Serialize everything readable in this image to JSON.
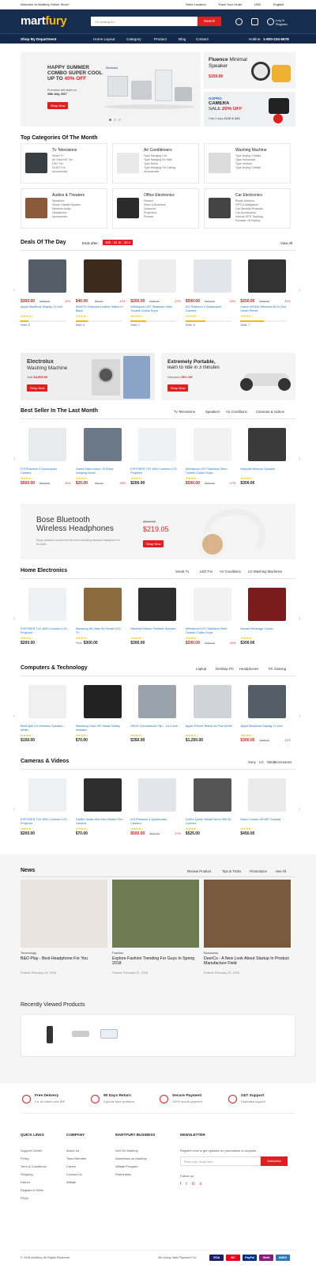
{
  "topbar": {
    "welcome": "Welcome to Martfury Online Store !",
    "store_location": "Store Location",
    "track_order": "Track Your Order",
    "currency": "USD",
    "language": "English"
  },
  "header": {
    "logo_a": "mart",
    "logo_b": "fury",
    "search_placeholder": "I'm looking for...",
    "search_button": "Search",
    "login": "Log In",
    "register": "Register"
  },
  "nav": {
    "shop_by_department": "Shop By Department",
    "items": [
      "Home Layout",
      "Category",
      "Product",
      "Blog",
      "Contact"
    ],
    "hotline_label": "Hotline:",
    "hotline": "1-800-234-5678"
  },
  "hero": {
    "line1": "HAPPY SUMMER",
    "line2": "COMBO SUPER COOL",
    "line3": "UP TO",
    "discount": "40% OFF",
    "brand": "Electrolux",
    "promo_note": "Promotion will expire on",
    "promo_date": "30th July, 2017",
    "button": "Shop Now",
    "right1": {
      "title": "Fluence",
      "title2": "Minimal",
      "title3": "Speaker",
      "price": "$159.99"
    },
    "right2": {
      "title": "GOPRO",
      "title2": "CAMERA",
      "title3": "SALE",
      "discount": "20% OFF",
      "note": "Only 3 days",
      "date": "21/10 & 3/10"
    }
  },
  "categories": {
    "title": "Top Categories Of The Month",
    "items": [
      {
        "name": "Tv Televisions",
        "subs": [
          "Smart Tv",
          "4K Ultra HD Tvs",
          "LED Tvs",
          "OLED Tvs",
          "Accessories"
        ]
      },
      {
        "name": "Air Conditioners",
        "subs": [
          "Type Hanging Cell",
          "Type Hanging On Wall",
          "Type Direct",
          "Type Hanging On Ceiling",
          "Accessories"
        ]
      },
      {
        "name": "Washing Machine",
        "subs": [
          "Type Drying Clothes",
          "Type Horizontal",
          "Type Vertical",
          "Type Drying Clothes"
        ]
      },
      {
        "name": "Audios & Theaters",
        "subs": [
          "Speakers",
          "Home Theater System",
          "Wireless Audio",
          "Headphone",
          "Accessories"
        ]
      },
      {
        "name": "Office Electronics",
        "subs": [
          "Printers",
          "Store & Business",
          "Scanners",
          "Projectors",
          "Phones"
        ]
      },
      {
        "name": "Car Electronics",
        "subs": [
          "Radar Detector",
          "GPS & Navigation",
          "Car Security Products",
          "Car Accessories",
          "Vehicle GPS Tracking",
          "Portable CB Radios"
        ]
      }
    ]
  },
  "deals": {
    "title": "Deals Of The Day",
    "ends_label": "Ends after:",
    "timer": "16h : 31 m : 10 s",
    "view_all": "View All",
    "items": [
      {
        "price": "$300.00",
        "old": "$399.00",
        "disc": "-11%",
        "name": "Apple MacBook Display 12 inch",
        "sold": "Sold: 9"
      },
      {
        "price": "$40.00",
        "old": "$60.00",
        "disc": "-11%",
        "name": "MVMTH Classical Leather Watch In Black",
        "sold": "Sold: 6"
      },
      {
        "price": "$200.00",
        "old": "$299.00",
        "disc": "-17%",
        "name": "Whirlepool UST Stainless Steel Tumble Clothe Dryer",
        "sold": "Sold: 1"
      },
      {
        "price": "$500.00",
        "old": "$599.00",
        "disc": "-11%",
        "name": "DJI Phantom 4 Quadcopter Camera",
        "sold": "Sold: 6"
      },
      {
        "price": "$250.00",
        "old": "$299.00",
        "disc": "-11%",
        "name": "Canon MX460 Wireless All-In-One Smart Printer",
        "sold": "Sold: 7"
      }
    ]
  },
  "banners": {
    "b1": {
      "brand": "Electrolux",
      "title": "Washing Machine",
      "price_label": "Just",
      "price": "$4,599.00",
      "button": "Shop Now"
    },
    "b2": {
      "title1": "Extremely Portable,",
      "title2": "learn to ride in 3 minutes",
      "discount_label": "Discount",
      "discount": "25% Off",
      "button": "Shop Now"
    }
  },
  "bestseller": {
    "title": "Best Seller In The Last Month",
    "tabs": [
      "Tv Televisions",
      "Speakers",
      "Air Conditions",
      "Cameras & Videos"
    ],
    "items": [
      {
        "name": "DJI Phantom 4 Quadcopter Camera",
        "price": "$500.00",
        "old": "$600.00",
        "disc": "-11%"
      },
      {
        "name": "Grand Slam Indoor Of Show Jumping Novel",
        "price": "$20.00",
        "old": "$30.00",
        "disc": "-33%"
      },
      {
        "name": "EXPOSER T20 1600 Lumens LCD Projector",
        "price": "$200.00",
        "old": "",
        "disc": ""
      },
      {
        "name": "Whirlepool UST Stainless Steel Tumble Clothe Dryer",
        "price": "$500.00",
        "old": "$600.00",
        "disc": "-17%"
      },
      {
        "name": "Marshall Woburn Speaker",
        "price": "$300.00",
        "old": "",
        "disc": ""
      }
    ]
  },
  "bose": {
    "title1": "Bose Bluetooth",
    "title2": "Wireless Headphones",
    "old": "$299.00",
    "price": "$219.05",
    "desc": "Enjoy powerful sound from the best sounding wireless headphone in its class",
    "button": "Shop Now"
  },
  "home_electronics": {
    "title": "Home Electronics",
    "tabs": [
      "Smart Tv",
      "LED Tvs",
      "Air Conditions",
      "LG Washing Machines"
    ],
    "items": [
      {
        "name": "EXPOSER T20 1600 Lumens LCD Projector",
        "price": "$200.00",
        "old": "",
        "disc": ""
      },
      {
        "name": "Samsung 4K Ultra HD Smart LED TV",
        "price": "$300.00",
        "old": "",
        "disc": "",
        "from": "From"
      },
      {
        "name": "Marshall Kilburn Portable Speaker",
        "price": "$300.00",
        "old": "",
        "disc": ""
      },
      {
        "name": "Whirlepool UST Stainless Steel Tumble Clothe Dryer",
        "price": "$200.00",
        "old": "$299.00",
        "disc": "-15%"
      },
      {
        "name": "Newair Beverage Cooler",
        "price": "$300.00",
        "old": "",
        "disc": ""
      }
    ]
  },
  "computers": {
    "title": "Computers & Technology",
    "tabs": [
      "Laptop",
      "Desktop PC",
      "Headphones",
      "PC Gaming"
    ],
    "items": [
      {
        "name": "Beat Spill 2.0 Wireless Speaker – White",
        "price": "$150.00",
        "old": "",
        "disc": ""
      },
      {
        "name": "Samsung Gear VR Virtual Reality Headset",
        "price": "$70.00",
        "old": "",
        "disc": ""
      },
      {
        "name": "ASUS Chromebook Flip – 10.2 inch",
        "price": "$350.00",
        "old": "",
        "disc": ""
      },
      {
        "name": "Apple iPhone Retina 6s Plus 64GB",
        "price": "$1,250.00",
        "old": "",
        "disc": ""
      },
      {
        "name": "Apple MacBook Display 12 inch",
        "price": "$300.00",
        "old": "$399.00",
        "disc": "-11%"
      }
    ]
  },
  "cameras": {
    "title": "Cameras & Videos",
    "tabs": [
      "Sony",
      "LG",
      "Nikon",
      "Accessories"
    ],
    "items": [
      {
        "name": "EXPOSER T20 1600 Lumens LCD Projector",
        "price": "$200.00",
        "old": "",
        "disc": ""
      },
      {
        "name": "Fujifilm Instax Mini Neo Instant Film Camera",
        "price": "$70.00",
        "old": "",
        "disc": ""
      },
      {
        "name": "DJI Phantom 4 Quadcopter Camera",
        "price": "$500.00",
        "old": "$600.00",
        "disc": "-17%"
      },
      {
        "name": "GoPro Quick Virtual Hero4 360 4K Camera",
        "price": "$525.00",
        "old": "",
        "disc": ""
      },
      {
        "name": "Nikon Coolpix 3H WF Camera",
        "price": "$450.00",
        "old": "",
        "disc": ""
      }
    ]
  },
  "news": {
    "title": "News",
    "tabs": [
      "Review Product",
      "Tips & Tricks",
      "Promotions",
      "See All"
    ],
    "items": [
      {
        "cat": "Technology",
        "title": "B&O Play - Best Headphone For You",
        "date": "Posted: February 24, 2018"
      },
      {
        "cat": "Fashion",
        "title": "Explore Fashion Trending For Guys In Spring 2018",
        "date": "Posted: February 22, 2018"
      },
      {
        "cat": "Bussiness",
        "title": "DeerCo - A New Look About Startup In Product Manufacture Field",
        "date": "Posted: February 22, 2018"
      }
    ]
  },
  "recent": {
    "title": "Recently Viewed Products"
  },
  "features": [
    {
      "title": "Free Delivery",
      "sub": "For all orders over $99"
    },
    {
      "title": "90 Days Return",
      "sub": "If goods have problems"
    },
    {
      "title": "Secure Payment",
      "sub": "100% secure payment"
    },
    {
      "title": "24/7 Support",
      "sub": "Dedicated support"
    }
  ],
  "footer": {
    "quick_links": {
      "title": "QUICK LINKS",
      "items": [
        "Support Center",
        "Policy",
        "Term & Conditions",
        "Shipping",
        "Return",
        "Register A Seller",
        "FAQs"
      ]
    },
    "company": {
      "title": "COMPANY",
      "items": [
        "About Us",
        "Team Member",
        "Career",
        "Contact Us",
        "Affilate"
      ]
    },
    "business": {
      "title": "MARTFURY BUSINESS",
      "items": [
        "Sell On Martfury",
        "Advertises on Martfury",
        "Affilate Program",
        "Partnership"
      ]
    },
    "newsletter": {
      "title": "NEWSLETTER",
      "text": "Register now to get updates on promotions & coupons",
      "placeholder": "Enter your email here...",
      "button": "Subscribe",
      "follow": "Follow us"
    },
    "copyright": "© 2018 Martfury. All Rights Reserved",
    "secure": "We Using Safe Payment For:",
    "payments": [
      "VISA",
      "MC",
      "PayPal",
      "Skrill",
      "AMEX"
    ]
  },
  "colors": {
    "navy": "#162d50",
    "red": "#e02020",
    "yellow": "#fcb800",
    "link": "#1e73be"
  }
}
